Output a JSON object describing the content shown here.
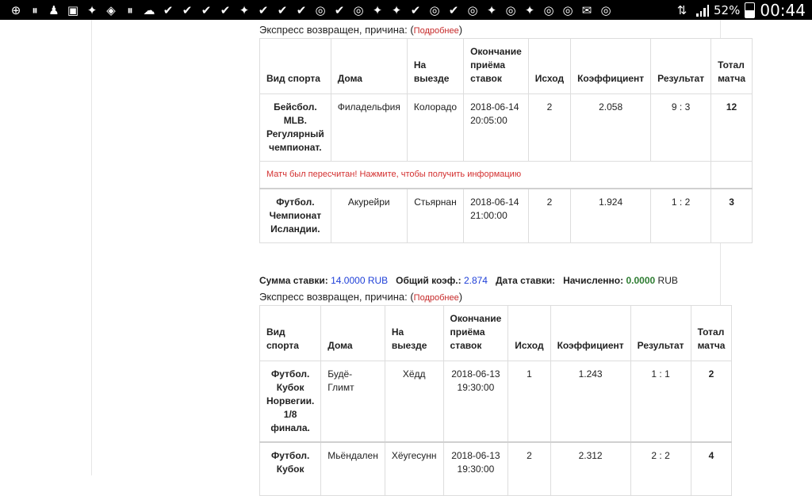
{
  "status_bar": {
    "icons": [
      "plus-circle-icon",
      "pause-icon",
      "person-icon",
      "image-icon",
      "twitter-icon",
      "wifi-box-icon",
      "pause-icon",
      "cloud-icon",
      "check-icon",
      "check-gear-icon",
      "check-icon",
      "check-icon",
      "twitter-icon",
      "check-icon",
      "check-icon",
      "check-icon",
      "chrome-icon",
      "check-icon",
      "chrome-icon",
      "twitter-icon",
      "twitter-icon",
      "check-icon",
      "chrome-icon",
      "check-icon",
      "chrome-icon",
      "twitter-icon",
      "chrome-icon",
      "twitter-icon",
      "chrome-icon",
      "chrome-icon",
      "gmail-icon",
      "chrome-icon"
    ],
    "battery_percent": "52%",
    "time": "00:44"
  },
  "express1": {
    "reason_prefix": "Экспресс возвращен, причина: (",
    "reason_link": "Подробнее",
    "reason_suffix": ")",
    "headers": [
      "Вид спорта",
      "Дома",
      "На выезде",
      "Окончание приёма ставок",
      "Исход",
      "Коэффициент",
      "Результат",
      "Тотал матча"
    ],
    "rows": [
      {
        "sport": "Бейсбол. MLB. Регулярный чемпионат.",
        "home": "Филадельфия",
        "away": "Колорадо",
        "end": "2018-06-14 20:05:00",
        "outcome": "2",
        "coef": "2.058",
        "result": "9 : 3",
        "total": "12"
      },
      {
        "sport": "Футбол. Чемпионат Исландии.",
        "home": "Акурейри",
        "away": "Стьярнан",
        "end": "2018-06-14 21:00:00",
        "outcome": "2",
        "coef": "1.924",
        "result": "1 : 2",
        "total": "3"
      }
    ],
    "notice": "Матч был пересчитан! Нажмите, чтобы получить информацию"
  },
  "summary": {
    "stake_label": "Сумма ставки:",
    "stake_value": "14.0000 RUB",
    "coef_label": "Общий коэф.:",
    "coef_value": "2.874",
    "date_label": "Дата ставки:",
    "date_value": "",
    "credited_label": "Начисленно:",
    "credited_value": "0.0000",
    "credited_currency": "RUB"
  },
  "express2": {
    "reason_prefix": "Экспресс возвращен, причина: (",
    "reason_link": "Подробнее",
    "reason_suffix": ")",
    "headers": [
      "Вид спорта",
      "Дома",
      "На выезде",
      "Окончание приёма ставок",
      "Исход",
      "Коэффициент",
      "Результат",
      "Тотал матча"
    ],
    "rows": [
      {
        "sport": "Футбол. Кубок Норвегии. 1/8 финала.",
        "home": "Будё-Глимт",
        "away": "Хёдд",
        "end": "2018-06-13 19:30:00",
        "outcome": "1",
        "coef": "1.243",
        "result": "1 : 1",
        "total": "2"
      },
      {
        "sport": "Футбол. Кубок",
        "home": "Мьёндален",
        "away": "Хёугесунн",
        "end": "2018-06-13 19:30:00",
        "outcome": "2",
        "coef": "2.312",
        "result": "2 : 2",
        "total": "4"
      }
    ]
  }
}
